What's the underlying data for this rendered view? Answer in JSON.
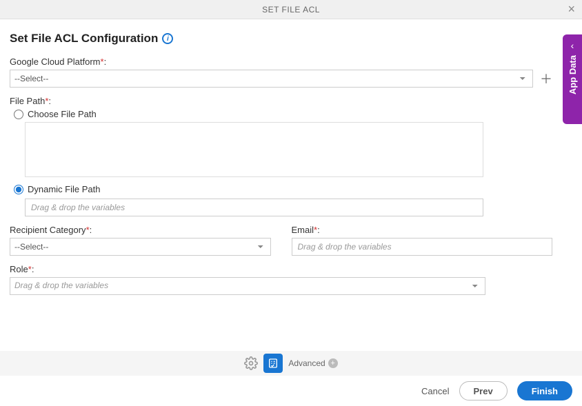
{
  "header": {
    "title": "SET FILE ACL"
  },
  "section_title": "Set File ACL Configuration",
  "fields": {
    "gcp": {
      "label": "Google Cloud Platform",
      "selected": "--Select--"
    },
    "file_path": {
      "label": "File Path",
      "choose_label": "Choose File Path",
      "dynamic_label": "Dynamic File Path",
      "dynamic_placeholder": "Drag & drop the variables"
    },
    "recipient_category": {
      "label": "Recipient Category",
      "selected": "--Select--"
    },
    "email": {
      "label": "Email",
      "placeholder": "Drag & drop the variables"
    },
    "role": {
      "label": "Role",
      "placeholder": "Drag & drop the variables"
    }
  },
  "side_tab": {
    "label": "App Data"
  },
  "adv_bar": {
    "label": "Advanced"
  },
  "footer": {
    "cancel": "Cancel",
    "prev": "Prev",
    "finish": "Finish"
  }
}
